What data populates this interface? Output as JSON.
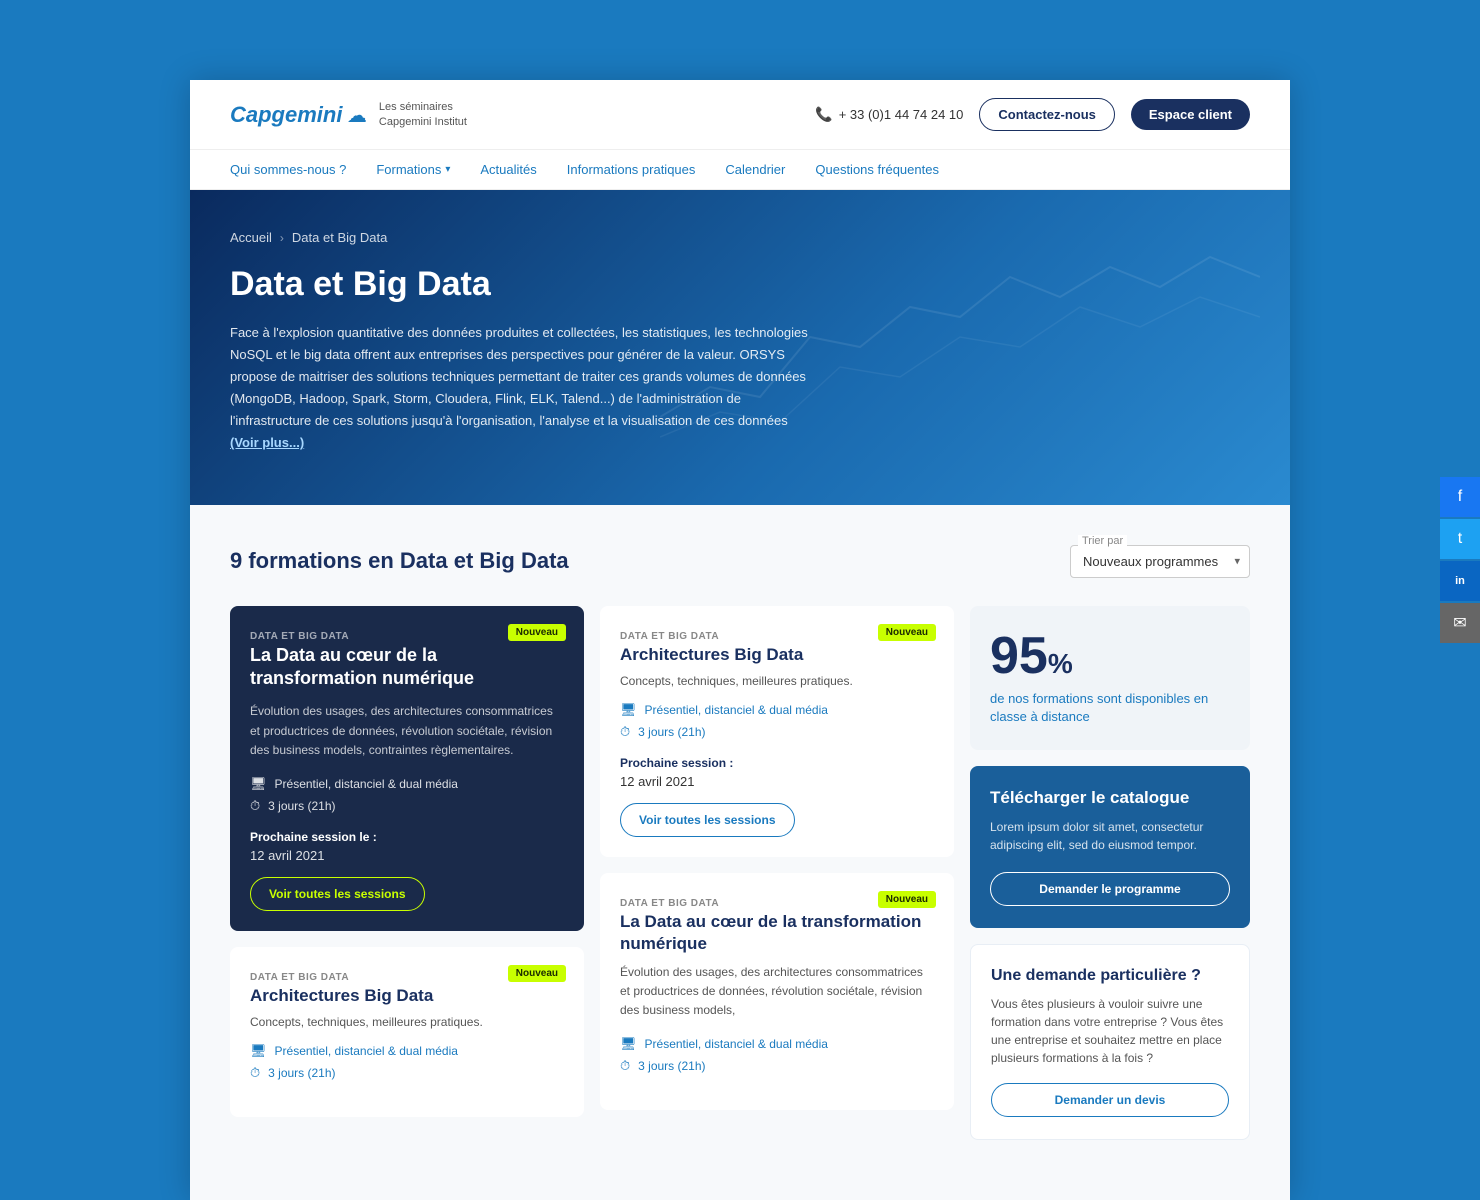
{
  "header": {
    "logo_text": "Capgemini",
    "logo_subtitle_line1": "Les séminaires",
    "logo_subtitle_line2": "Capgemini Institut",
    "phone": "+ 33 (0)1 44 74 24 10",
    "btn_contact": "Contactez-nous",
    "btn_espace": "Espace client"
  },
  "nav": {
    "items": [
      {
        "label": "Qui sommes-nous ?",
        "arrow": false
      },
      {
        "label": "Formations",
        "arrow": true
      },
      {
        "label": "Actualités",
        "arrow": false
      },
      {
        "label": "Informations pratiques",
        "arrow": false
      },
      {
        "label": "Calendrier",
        "arrow": false
      },
      {
        "label": "Questions fréquentes",
        "arrow": false
      }
    ]
  },
  "hero": {
    "breadcrumb_home": "Accueil",
    "breadcrumb_current": "Data et Big Data",
    "title": "Data et Big Data",
    "description": "Face à l'explosion quantitative des données produites et collectées, les statistiques, les technologies NoSQL et le big data offrent aux entreprises des perspectives pour générer de la valeur. ORSYS propose de maitriser des solutions techniques permettant de traiter ces grands volumes de données (MongoDB, Hadoop, Spark, Storm, Cloudera, Flink, ELK, Talend...) de l'administration de l'infrastructure de ces solutions jusqu'à l'organisation, l'analyse et la visualisation de ces données",
    "voir_plus": "(Voir plus...)"
  },
  "main": {
    "count_label": "9 formations en Data et Big Data",
    "sort_label": "Trier par",
    "sort_option": "Nouveaux programmes"
  },
  "cards": [
    {
      "id": "card1",
      "category": "DATA ET BIG DATA",
      "badge": "Nouveau",
      "title": "La Data au cœur de la transformation numérique",
      "description": "Évolution des usages, des architectures consommatrices et productrices de données, révolution sociétale, révision des business models, contraintes règlementaires.",
      "modality": "Présentiel, distanciel & dual média",
      "duration": "3 jours (21h)",
      "session_label": "Prochaine session le :",
      "session_date": "12 avril 2021",
      "btn_label": "Voir toutes les sessions",
      "dark": true
    },
    {
      "id": "card2",
      "category": "DATA ET BIG DATA",
      "badge": "Nouveau",
      "title": "Architectures Big Data",
      "description": "",
      "subtitle": "Concepts, techniques, meilleures pratiques.",
      "modality": "Présentiel, distanciel & dual média",
      "duration": "3 jours (21h)",
      "session_label": "",
      "session_date": "",
      "btn_label": "Voir toutes les sessions",
      "dark": false
    },
    {
      "id": "card3",
      "category": "DATA ET BIG DATA",
      "badge": "Nouveau",
      "title": "Architectures Big Data",
      "subtitle": "Concepts, techniques, meilleures pratiques.",
      "modality": "Présentiel, distanciel & dual média",
      "duration": "3 jours (21h)",
      "dark": false,
      "second_section": true
    },
    {
      "id": "card4",
      "category": "DATA ET BIG DATA",
      "badge": "Nouveau",
      "title": "La Data au cœur de la transformation numérique",
      "subtitle": "",
      "description": "Évolution des usages, des architectures consommatrices et productrices de données, révolution sociétale, révision des business models,",
      "modality": "Présentiel, distanciel & dual média",
      "duration": "3 jours (21h)",
      "dark": false
    }
  ],
  "sidebar": {
    "stat_number": "95",
    "stat_percent": "%",
    "stat_text": "de nos formations sont disponibles en classe à distance",
    "catalogue_title": "Télécharger le catalogue",
    "catalogue_text": "Lorem ipsum dolor sit amet, consectetur adipiscing elit, sed do eiusmod tempor.",
    "btn_programme": "Demander le programme",
    "demande_title": "Une demande particulière ?",
    "demande_text": "Vous êtes plusieurs à vouloir suivre une formation dans votre entreprise ? Vous êtes une entreprise et souhaitez mettre en place plusieurs formations à la fois ?",
    "btn_devis": "Demander un devis"
  },
  "social": {
    "fb_icon": "f",
    "tw_icon": "t",
    "li_icon": "in",
    "em_icon": "✉"
  }
}
